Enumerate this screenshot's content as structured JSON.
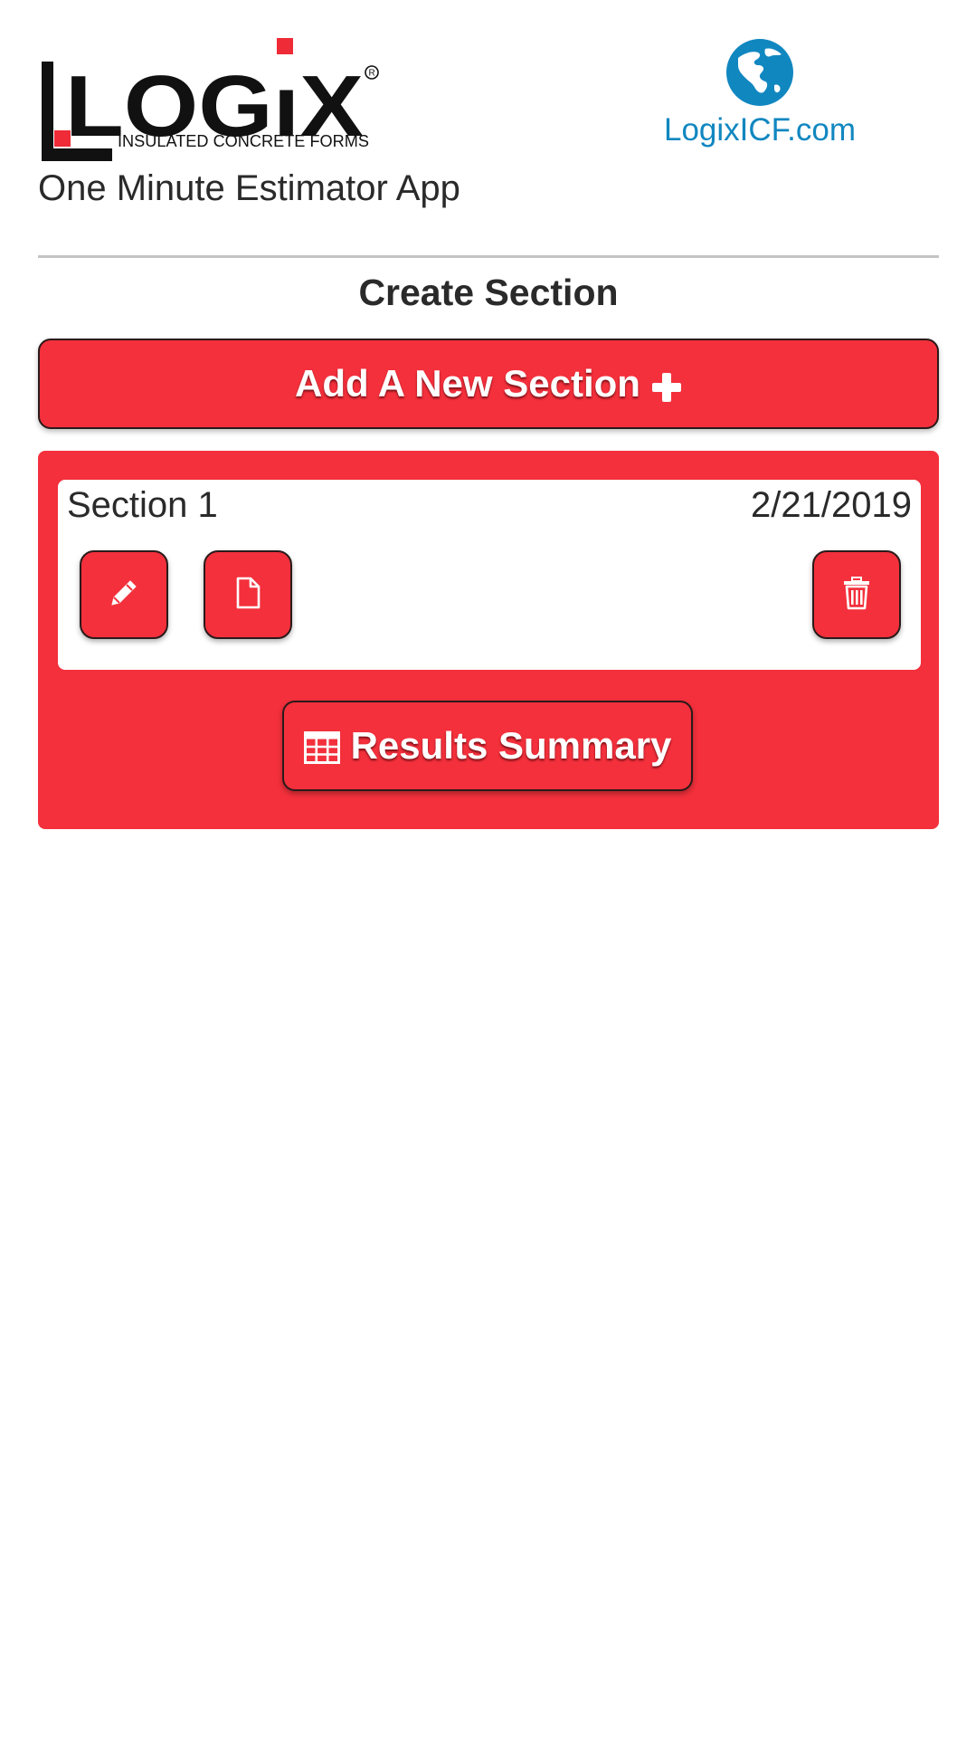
{
  "header": {
    "logo": {
      "brand": "LOGIX",
      "tagline": "INSULATED CONCRETE FORMS",
      "registered_mark": "®"
    },
    "app_title": "One Minute Estimator App",
    "site_link": {
      "label": "LogixICF.com",
      "icon": "globe-icon"
    }
  },
  "page": {
    "heading": "Create Section",
    "add_button": {
      "label": "Add A New Section",
      "icon": "plus-icon"
    }
  },
  "sections": [
    {
      "name": "Section 1",
      "date": "2/21/2019",
      "actions": {
        "edit_icon": "pencil-icon",
        "document_icon": "file-icon",
        "delete_icon": "trash-icon"
      }
    }
  ],
  "results_button": {
    "label": "Results Summary",
    "icon": "table-icon"
  },
  "colors": {
    "accent": "#f3303c",
    "link": "#1187c0",
    "text": "#2a2a2a",
    "divider": "#c4c4c4"
  }
}
